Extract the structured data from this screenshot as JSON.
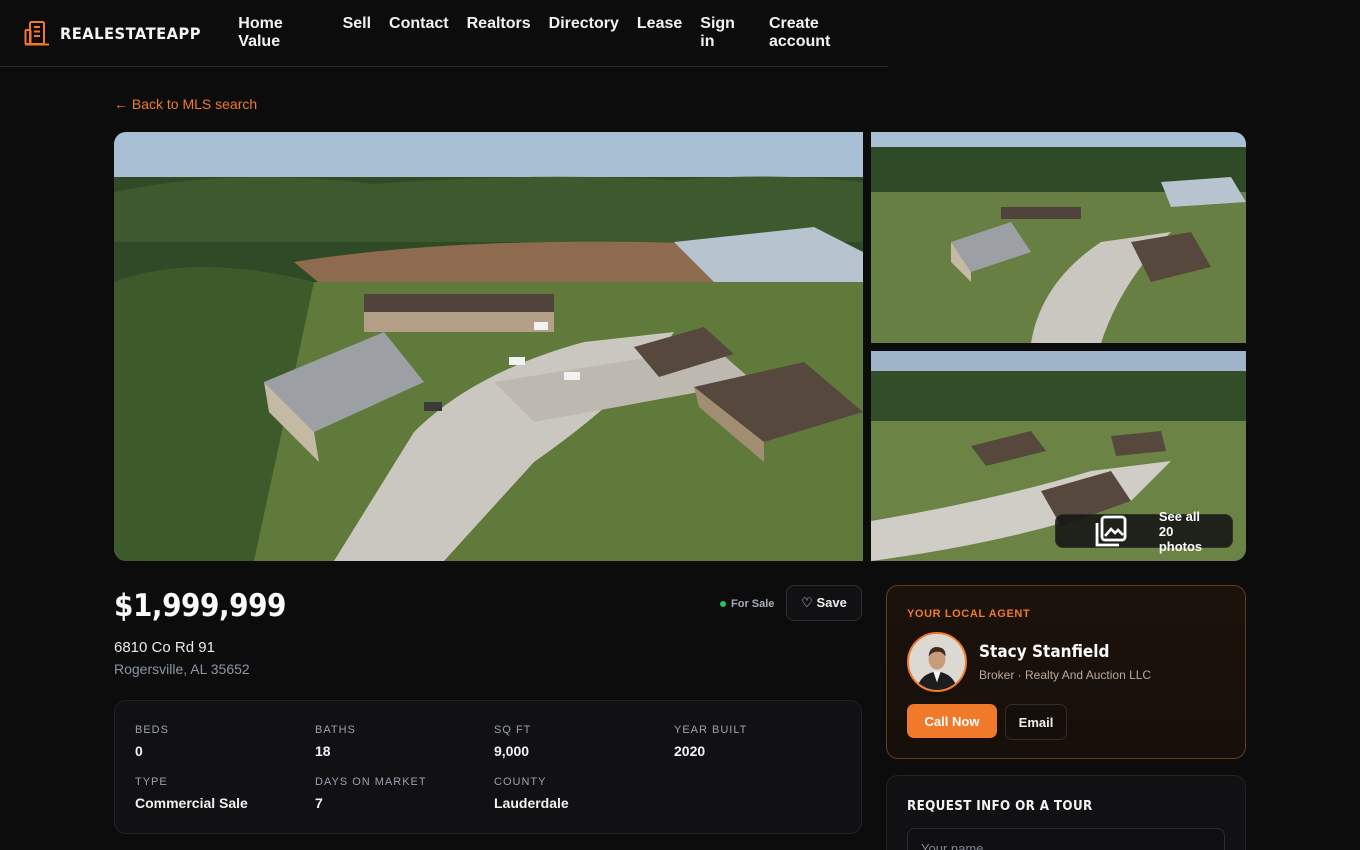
{
  "brand": {
    "name": "REALESTATEAPP",
    "logo_icon": "building-icon",
    "accent": "#f07a2a"
  },
  "nav": [
    "Home Value",
    "Sell",
    "Contact",
    "Realtors",
    "Directory",
    "Lease",
    "Sign in",
    "Create account"
  ],
  "back_link": "← Back to MLS search",
  "gallery": {
    "see_all_label": "See all 20 photos",
    "see_all_icon": "photos-icon"
  },
  "listing": {
    "price": "$1,999,999",
    "address_line1": "6810 Co Rd 91",
    "address_line2": "Rogersville, AL 35652",
    "status": "For Sale",
    "status_color": "#22c55e",
    "save_label": "♡ Save"
  },
  "facts": [
    {
      "label": "BEDS",
      "value": "0"
    },
    {
      "label": "BATHS",
      "value": "18"
    },
    {
      "label": "SQ FT",
      "value": "9,000"
    },
    {
      "label": "YEAR BUILT",
      "value": "2020"
    },
    {
      "label": "TYPE",
      "value": "Commercial Sale"
    },
    {
      "label": "DAYS ON MARKET",
      "value": "7"
    },
    {
      "label": "COUNTY",
      "value": "Lauderdale"
    }
  ],
  "agent": {
    "kicker": "YOUR LOCAL AGENT",
    "name": "Stacy Stanfield",
    "meta": "Broker · Realty And Auction LLC",
    "call_label": " Call Now",
    "email_label": "Email"
  },
  "request": {
    "title": "REQUEST INFO OR A TOUR",
    "name_placeholder": "Your name"
  }
}
